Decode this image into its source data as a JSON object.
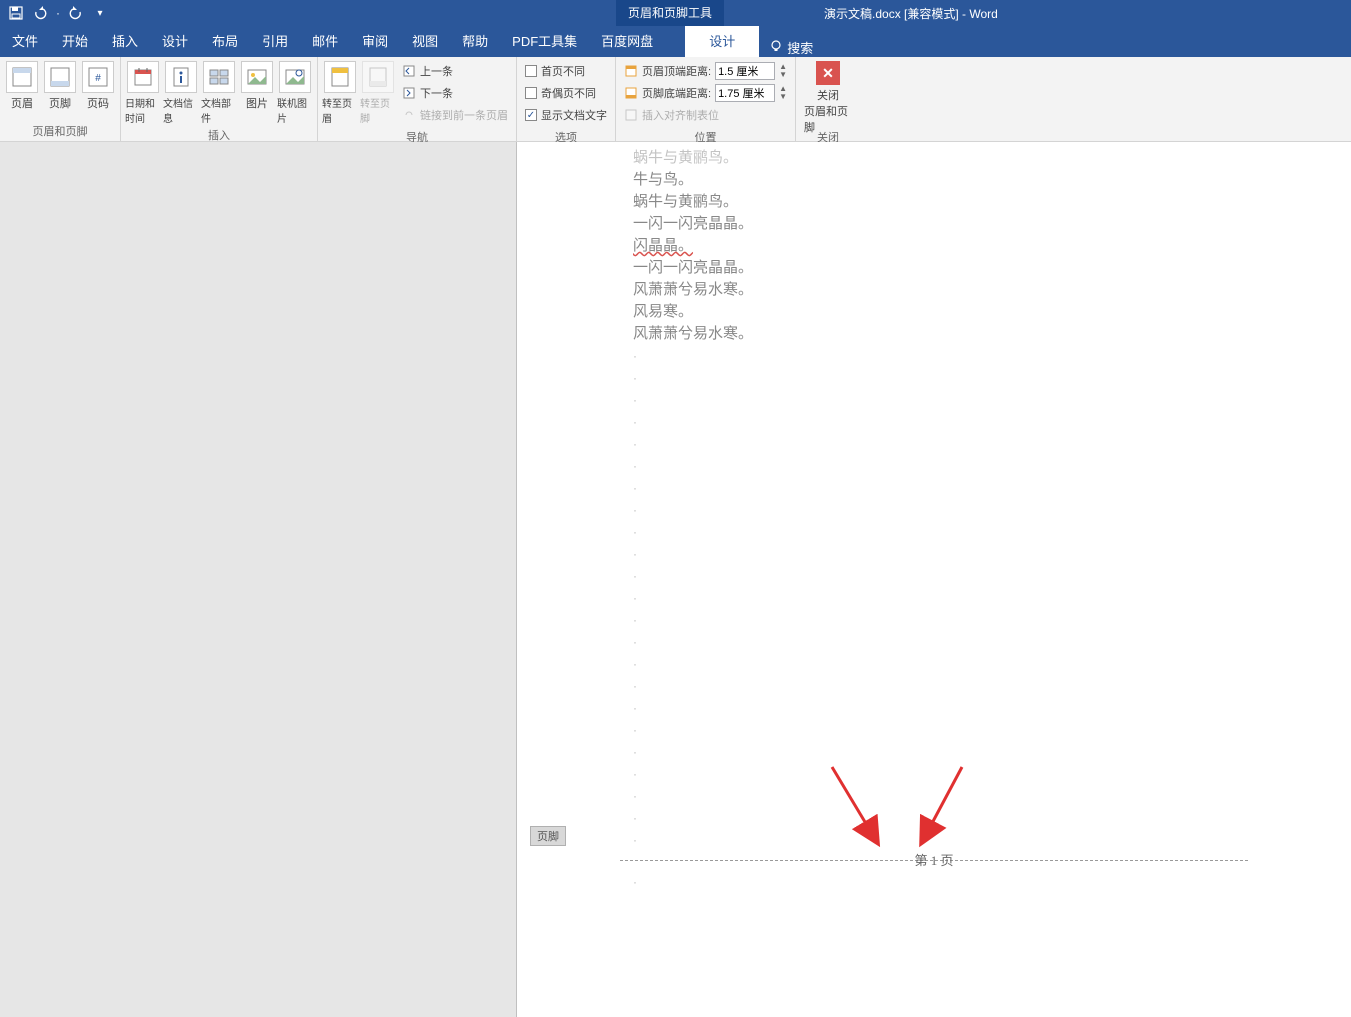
{
  "titlebar": {
    "contextual_label": "页眉和页脚工具",
    "doc_title": "演示文稿.docx [兼容模式] - Word"
  },
  "tabs": {
    "file": "文件",
    "home": "开始",
    "insert": "插入",
    "design": "设计",
    "layout": "布局",
    "references": "引用",
    "mailings": "邮件",
    "review": "审阅",
    "view": "视图",
    "help": "帮助",
    "pdf": "PDF工具集",
    "baidu": "百度网盘",
    "contextual_design": "设计",
    "search": "搜索"
  },
  "ribbon": {
    "group1": {
      "header": "页眉",
      "footer": "页脚",
      "page_number": "页码",
      "label": "页眉和页脚"
    },
    "group2": {
      "datetime": "日期和时间",
      "docinfo": "文档信息",
      "docparts": "文档部件",
      "pictures": "图片",
      "online_pics": "联机图片",
      "label": "插入"
    },
    "group3": {
      "goto_header": "转至页眉",
      "goto_footer": "转至页脚",
      "prev": "上一条",
      "next": "下一条",
      "link_prev": "链接到前一条页眉",
      "label": "导航"
    },
    "group4": {
      "diff_first": "首页不同",
      "diff_odd_even": "奇偶页不同",
      "show_doc_text": "显示文档文字",
      "label": "选项"
    },
    "group5": {
      "header_top": "页眉顶端距离:",
      "header_top_val": "1.5 厘米",
      "footer_bottom": "页脚底端距离:",
      "footer_bottom_val": "1.75 厘米",
      "insert_align": "插入对齐制表位",
      "label": "位置"
    },
    "group6": {
      "close": "关闭",
      "close_hf": "页眉和页脚",
      "label": "关闭"
    }
  },
  "document": {
    "lines": [
      "蜗牛与黄鹂鸟。",
      "牛与鸟。",
      "蜗牛与黄鹂鸟。",
      "一闪一闪亮晶晶。",
      "闪晶晶。",
      "一闪一闪亮晶晶。",
      "风萧萧兮易水寒。",
      "风易寒。",
      "风萧萧兮易水寒。"
    ],
    "footer_tag": "页脚",
    "footer_text": "第 1 页"
  }
}
